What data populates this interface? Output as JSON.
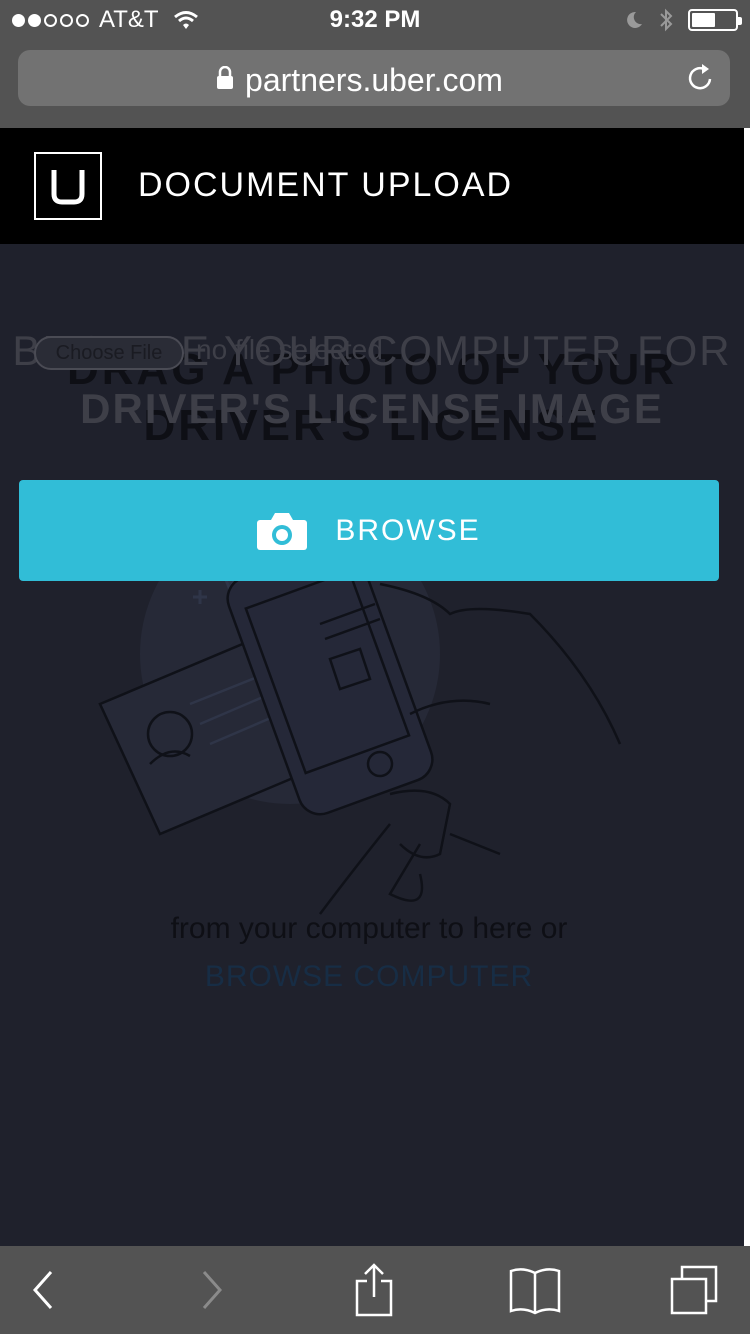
{
  "status_bar": {
    "carrier": "AT&T",
    "time": "9:32 PM",
    "signal_bars_filled": 2,
    "signal_bars_total": 5,
    "battery_level": 0.55
  },
  "browser": {
    "url": "partners.uber.com"
  },
  "header": {
    "title": "DOCUMENT UPLOAD"
  },
  "upload": {
    "drag_title_line1": "DRAG A PHOTO OF YOUR",
    "drag_title_line2": "DRIVER'S LICENSE",
    "browse_title_line1": "BROWSE YOUR COMPUTER FOR",
    "browse_title_line2": "DRIVER'S LICENSE IMAGE",
    "choose_file_label": "Choose File",
    "no_file_label": "no file selected",
    "browse_button_label": "BROWSE",
    "from_text": "from your computer to here or",
    "browse_link": "BROWSE COMPUTER"
  },
  "colors": {
    "accent": "#31bdd7",
    "overlay": "#1f212c",
    "header": "#000000",
    "chrome": "#535353"
  },
  "icons": {
    "lock": "lock-icon",
    "reload": "reload-icon",
    "camera": "camera-icon",
    "back": "back-arrow-icon",
    "forward": "forward-arrow-icon",
    "share": "share-icon",
    "bookmarks": "bookmarks-icon",
    "tabs": "tabs-icon"
  }
}
